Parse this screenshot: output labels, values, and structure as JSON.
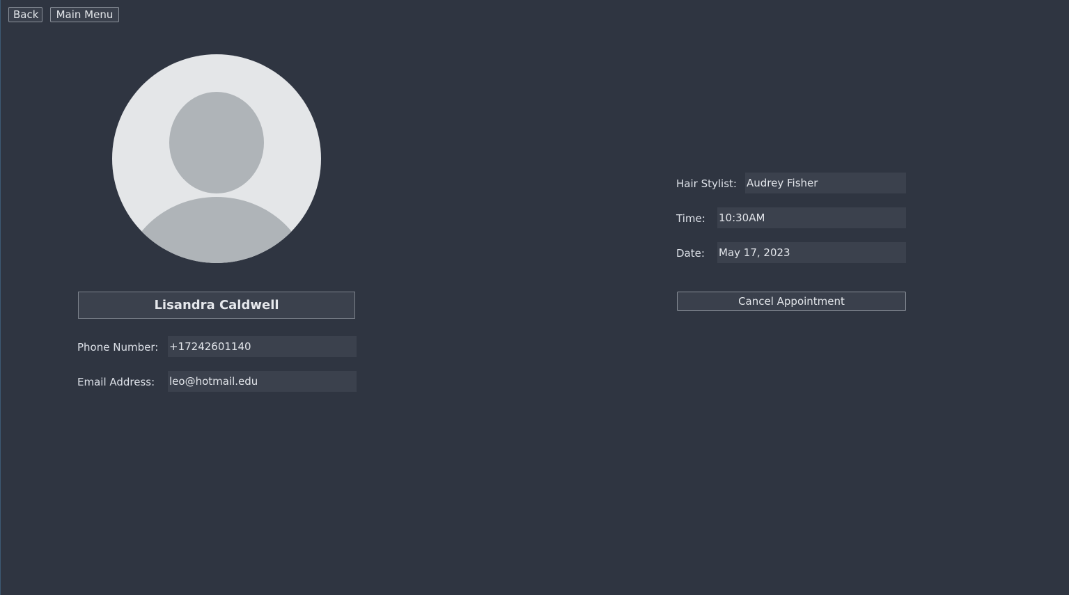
{
  "nav": {
    "back_label": "Back",
    "main_menu_label": "Main Menu"
  },
  "profile": {
    "name": "Lisandra Caldwell",
    "avatar_icon": "default-user-avatar-icon",
    "phone_label": "Phone Number:",
    "phone_value": "+17242601140",
    "email_label": "Email Address:",
    "email_value": "leo@hotmail.edu"
  },
  "appointment": {
    "stylist_label": "Hair Stylist:",
    "stylist_value": "Audrey Fisher",
    "time_label": "Time:",
    "time_value": "10:30AM",
    "date_label": "Date:",
    "date_value": "May 17, 2023",
    "cancel_label": "Cancel Appointment"
  },
  "colors": {
    "background": "#2f3541",
    "field_bg": "#3b414d",
    "avatar_bg": "#e4e6e8",
    "avatar_figure": "#afb4b8"
  }
}
